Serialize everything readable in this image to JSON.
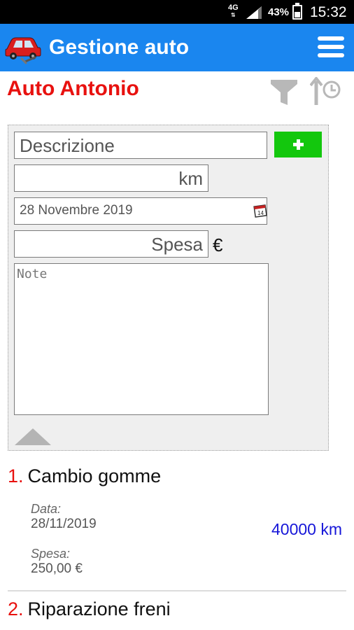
{
  "status_bar": {
    "network": "4G",
    "battery": "43%",
    "time": "15:32"
  },
  "app_bar": {
    "title": "Gestione auto",
    "logo_icon": "car-wrench-icon",
    "menu_icon": "hamburger-menu-icon",
    "color": "#1a86ef"
  },
  "header": {
    "car_name": "Auto Antonio",
    "car_name_color": "#e8110f",
    "filter_icon": "filter-icon",
    "sort_icon": "sort-by-date-icon"
  },
  "form": {
    "description_placeholder": "Descrizione",
    "add_button_icon": "plus-icon",
    "add_button_color": "#13c70d",
    "km_placeholder": "km",
    "date_value": "28 Novembre 2019",
    "calendar_icon": "calendar-icon",
    "expense_placeholder": "Spesa",
    "currency": "€",
    "notes_placeholder": "Note",
    "collapse_icon": "triangle-up-icon"
  },
  "entries": [
    {
      "number": "1.",
      "title": "Cambio gomme",
      "date_label": "Data:",
      "date": "28/11/2019",
      "expense_label": "Spesa:",
      "expense": "250,00 €",
      "km": "40000 km"
    },
    {
      "number": "2.",
      "title": "Riparazione freni"
    }
  ]
}
